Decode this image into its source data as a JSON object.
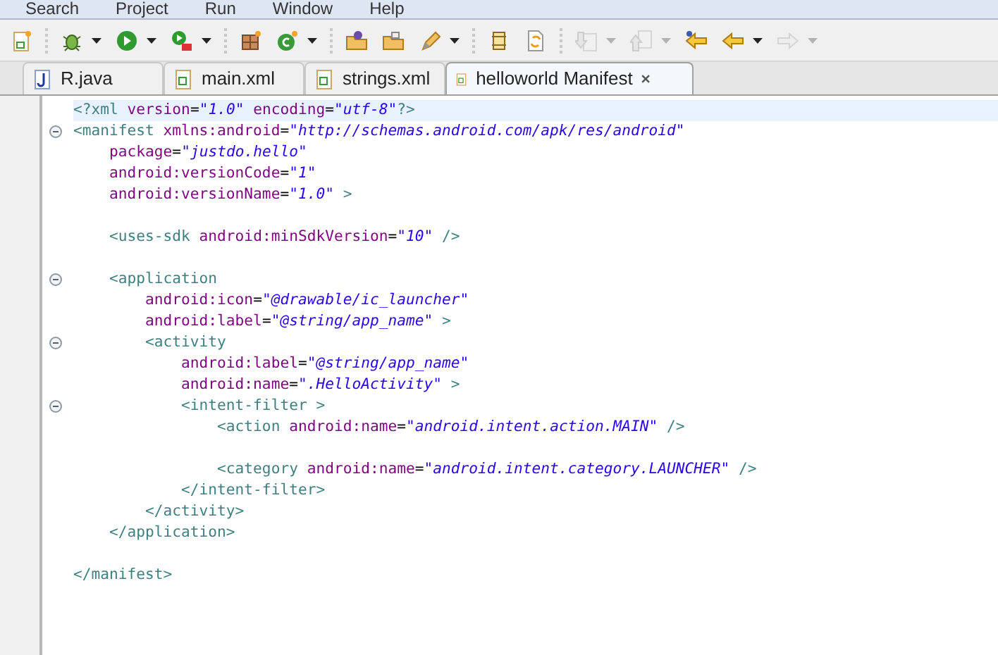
{
  "menu": [
    "Search",
    "Project",
    "Run",
    "Window",
    "Help"
  ],
  "toolbar": [
    [
      {
        "kind": "button",
        "disabled": false
      }
    ],
    [
      {
        "kind": "split",
        "disabled": false
      },
      {
        "kind": "split",
        "disabled": false
      },
      {
        "kind": "split",
        "disabled": false
      }
    ],
    [
      {
        "kind": "button",
        "disabled": false
      },
      {
        "kind": "split",
        "disabled": false
      }
    ],
    [
      {
        "kind": "button",
        "disabled": false
      },
      {
        "kind": "button",
        "disabled": false
      },
      {
        "kind": "split",
        "disabled": false
      }
    ],
    [
      {
        "kind": "button",
        "disabled": false
      },
      {
        "kind": "button",
        "disabled": false
      }
    ],
    [
      {
        "kind": "split",
        "disabled": true
      },
      {
        "kind": "split",
        "disabled": true
      },
      {
        "kind": "button",
        "disabled": false
      },
      {
        "kind": "split",
        "disabled": false
      },
      {
        "kind": "split",
        "disabled": true
      }
    ]
  ],
  "tabs": [
    {
      "label": "R.java",
      "kind": "java",
      "selected": false
    },
    {
      "label": "main.xml",
      "kind": "xml",
      "selected": false
    },
    {
      "label": "strings.xml",
      "kind": "xml",
      "selected": false
    },
    {
      "label": "helloworld Manifest",
      "kind": "xml",
      "selected": true
    }
  ],
  "editor": {
    "lines": [
      {
        "foldable": false,
        "current": true,
        "tokens": [
          {
            "kind": "tag",
            "text": "<?xml "
          },
          {
            "kind": "attr",
            "text": "version"
          },
          {
            "kind": "punct",
            "text": "="
          },
          {
            "kind": "value",
            "text": "\"1.0\""
          },
          {
            "kind": "attr",
            "text": " encoding"
          },
          {
            "kind": "punct",
            "text": "="
          },
          {
            "kind": "value",
            "text": "\"utf-8\""
          },
          {
            "kind": "tag",
            "text": "?>"
          }
        ]
      },
      {
        "foldable": true,
        "current": false,
        "tokens": [
          {
            "kind": "tag",
            "text": "<manifest "
          },
          {
            "kind": "attr",
            "text": "xmlns:android"
          },
          {
            "kind": "punct",
            "text": "="
          },
          {
            "kind": "value",
            "text": "\"http://schemas.android.com/apk/res/android\""
          }
        ]
      },
      {
        "foldable": false,
        "current": false,
        "tokens": [
          {
            "kind": "attr",
            "text": "    package"
          },
          {
            "kind": "punct",
            "text": "="
          },
          {
            "kind": "value",
            "text": "\"justdo.hello\""
          }
        ]
      },
      {
        "foldable": false,
        "current": false,
        "tokens": [
          {
            "kind": "attr",
            "text": "    android:versionCode"
          },
          {
            "kind": "punct",
            "text": "="
          },
          {
            "kind": "value",
            "text": "\"1\""
          }
        ]
      },
      {
        "foldable": false,
        "current": false,
        "tokens": [
          {
            "kind": "attr",
            "text": "    android:versionName"
          },
          {
            "kind": "punct",
            "text": "="
          },
          {
            "kind": "value",
            "text": "\"1.0\""
          },
          {
            "kind": "tag",
            "text": " >"
          }
        ]
      },
      {
        "foldable": false,
        "current": false
      },
      {
        "foldable": false,
        "current": false,
        "tokens": [
          {
            "kind": "tag",
            "text": "    <uses-sdk "
          },
          {
            "kind": "attr",
            "text": "android:minSdkVersion"
          },
          {
            "kind": "punct",
            "text": "="
          },
          {
            "kind": "value",
            "text": "\"10\""
          },
          {
            "kind": "tag",
            "text": " />"
          }
        ]
      },
      {
        "foldable": false,
        "current": false
      },
      {
        "foldable": true,
        "current": false,
        "tokens": [
          {
            "kind": "tag",
            "text": "    <application"
          }
        ]
      },
      {
        "foldable": false,
        "current": false,
        "tokens": [
          {
            "kind": "attr",
            "text": "        android:icon"
          },
          {
            "kind": "punct",
            "text": "="
          },
          {
            "kind": "value",
            "text": "\"@drawable/ic_launcher\""
          }
        ]
      },
      {
        "foldable": false,
        "current": false,
        "tokens": [
          {
            "kind": "attr",
            "text": "        android:label"
          },
          {
            "kind": "punct",
            "text": "="
          },
          {
            "kind": "value",
            "text": "\"@string/app_name\""
          },
          {
            "kind": "tag",
            "text": " >"
          }
        ]
      },
      {
        "foldable": true,
        "current": false,
        "tokens": [
          {
            "kind": "tag",
            "text": "        <activity"
          }
        ]
      },
      {
        "foldable": false,
        "current": false,
        "tokens": [
          {
            "kind": "attr",
            "text": "            android:label"
          },
          {
            "kind": "punct",
            "text": "="
          },
          {
            "kind": "value",
            "text": "\"@string/app_name\""
          }
        ]
      },
      {
        "foldable": false,
        "current": false,
        "tokens": [
          {
            "kind": "attr",
            "text": "            android:name"
          },
          {
            "kind": "punct",
            "text": "="
          },
          {
            "kind": "value",
            "text": "\".HelloActivity\""
          },
          {
            "kind": "tag",
            "text": " >"
          }
        ]
      },
      {
        "foldable": true,
        "current": false,
        "tokens": [
          {
            "kind": "tag",
            "text": "            <intent-filter >"
          }
        ]
      },
      {
        "foldable": false,
        "current": false,
        "tokens": [
          {
            "kind": "tag",
            "text": "                <action "
          },
          {
            "kind": "attr",
            "text": "android:name"
          },
          {
            "kind": "punct",
            "text": "="
          },
          {
            "kind": "value",
            "text": "\"android.intent.action.MAIN\""
          },
          {
            "kind": "tag",
            "text": " />"
          }
        ]
      },
      {
        "foldable": false,
        "current": false
      },
      {
        "foldable": false,
        "current": false,
        "tokens": [
          {
            "kind": "tag",
            "text": "                <category "
          },
          {
            "kind": "attr",
            "text": "android:name"
          },
          {
            "kind": "punct",
            "text": "="
          },
          {
            "kind": "value",
            "text": "\"android.intent.category.LAUNCHER\""
          },
          {
            "kind": "tag",
            "text": " />"
          }
        ]
      },
      {
        "foldable": false,
        "current": false,
        "tokens": [
          {
            "kind": "tag",
            "text": "            </intent-filter>"
          }
        ]
      },
      {
        "foldable": false,
        "current": false,
        "tokens": [
          {
            "kind": "tag",
            "text": "        </activity>"
          }
        ]
      },
      {
        "foldable": false,
        "current": false,
        "tokens": [
          {
            "kind": "tag",
            "text": "    </application>"
          }
        ]
      },
      {
        "foldable": false,
        "current": false
      },
      {
        "foldable": false,
        "current": false,
        "tokens": [
          {
            "kind": "tag",
            "text": "</manifest>"
          }
        ]
      }
    ]
  }
}
